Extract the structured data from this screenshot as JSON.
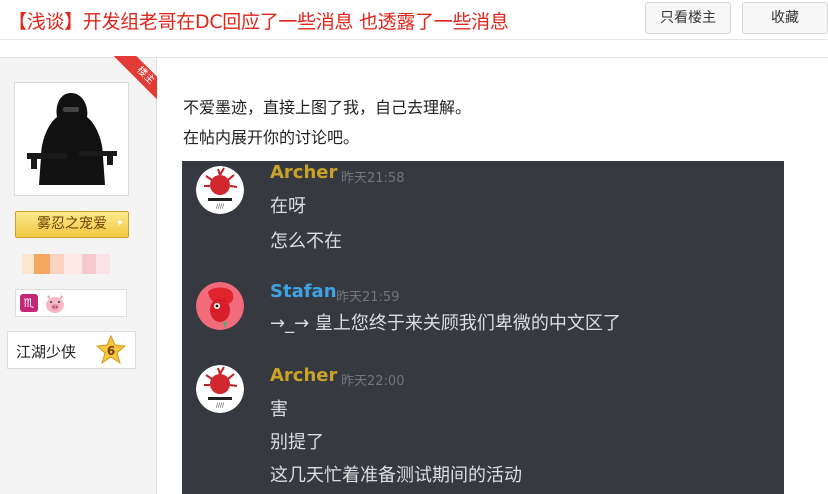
{
  "thread": {
    "title": "【浅谈】开发组老哥在DC回应了一些消息 也透露了一些消息",
    "only_op_label": "只看楼主",
    "favorite_label": "收藏"
  },
  "author": {
    "op_tag": "楼主",
    "rank_badge": "雾忍之宠爱",
    "level_title": "江湖少侠",
    "level_number": "6",
    "zodiac_glyph": "♏"
  },
  "post": {
    "line1": "不爱墨迹，直接上图了我，自己去理解。",
    "line2": "在帖内展开你的讨论吧。"
  },
  "discord": {
    "messages": [
      {
        "author": "Archer",
        "author_color": "#c9a227",
        "time": "昨天21:58",
        "lines": [
          "在呀",
          "怎么不在"
        ]
      },
      {
        "author": "Stafan",
        "author_color": "#3ea4e6",
        "time": "昨天21:59",
        "lines": [
          "→_→ 皇上您终于来关顾我们卑微的中文区了"
        ]
      },
      {
        "author": "Archer",
        "author_color": "#c9a227",
        "time": "昨天22:00",
        "lines": [
          "害",
          "别提了",
          "这几天忙着准备测试期间的活动"
        ]
      }
    ]
  },
  "colors": {
    "title_red": "#e1251b",
    "discord_bg": "#36393f",
    "discord_text": "#dcddde",
    "discord_time": "#72767d"
  }
}
